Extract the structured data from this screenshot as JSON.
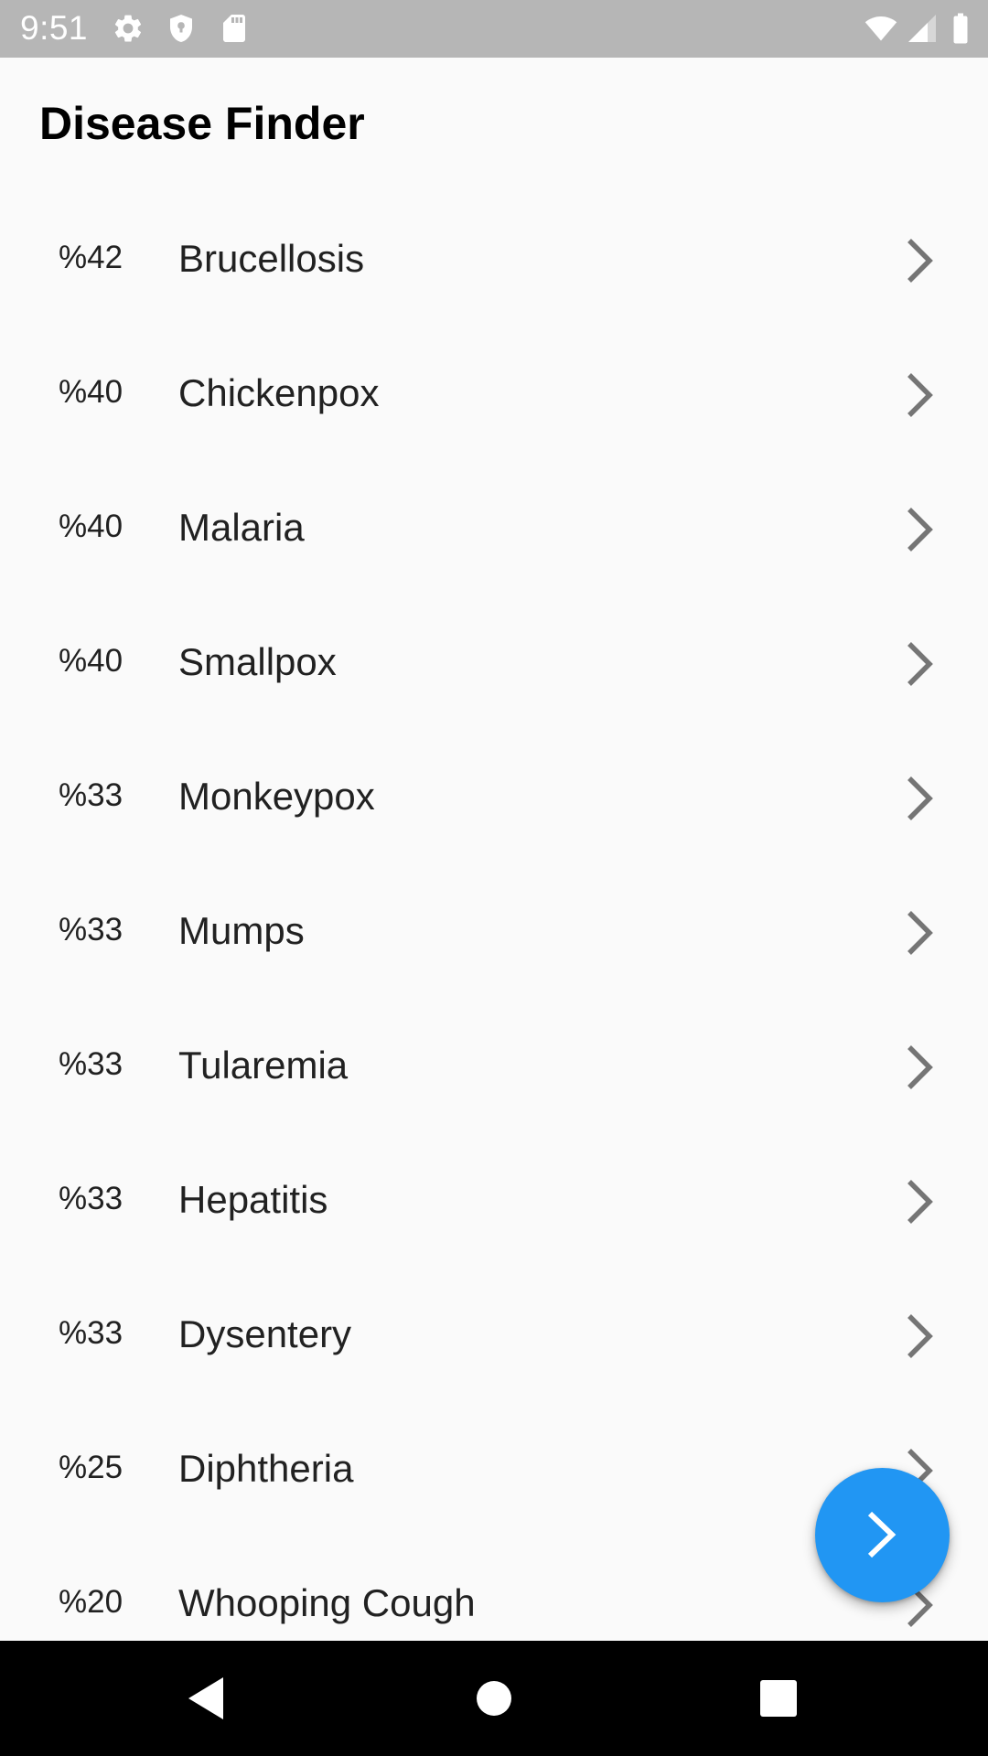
{
  "status_bar": {
    "time": "9:51",
    "icons_left": [
      "gear-icon",
      "shield-icon",
      "sd-card-icon"
    ],
    "icons_right": [
      "wifi-icon",
      "cell-signal-icon",
      "battery-icon"
    ]
  },
  "app_bar": {
    "title": "Disease Finder"
  },
  "diseases": [
    {
      "percent": "%42",
      "name": "Brucellosis"
    },
    {
      "percent": "%40",
      "name": "Chickenpox"
    },
    {
      "percent": "%40",
      "name": "Malaria"
    },
    {
      "percent": "%40",
      "name": "Smallpox"
    },
    {
      "percent": "%33",
      "name": "Monkeypox"
    },
    {
      "percent": "%33",
      "name": "Mumps"
    },
    {
      "percent": "%33",
      "name": "Tularemia"
    },
    {
      "percent": "%33",
      "name": "Hepatitis"
    },
    {
      "percent": "%33",
      "name": "Dysentery"
    },
    {
      "percent": "%25",
      "name": "Diphtheria"
    },
    {
      "percent": "%20",
      "name": "Whooping Cough"
    }
  ],
  "fab": {
    "icon": "chevron-right-icon"
  },
  "nav_bar": {
    "buttons": [
      "back-icon",
      "home-icon",
      "recents-icon"
    ]
  },
  "colors": {
    "status_bar_bg": "#b6b6b6",
    "page_bg": "#fafafa",
    "fab_bg": "#2196f3",
    "chevron": "#757575",
    "nav_bar_bg": "#000000"
  }
}
